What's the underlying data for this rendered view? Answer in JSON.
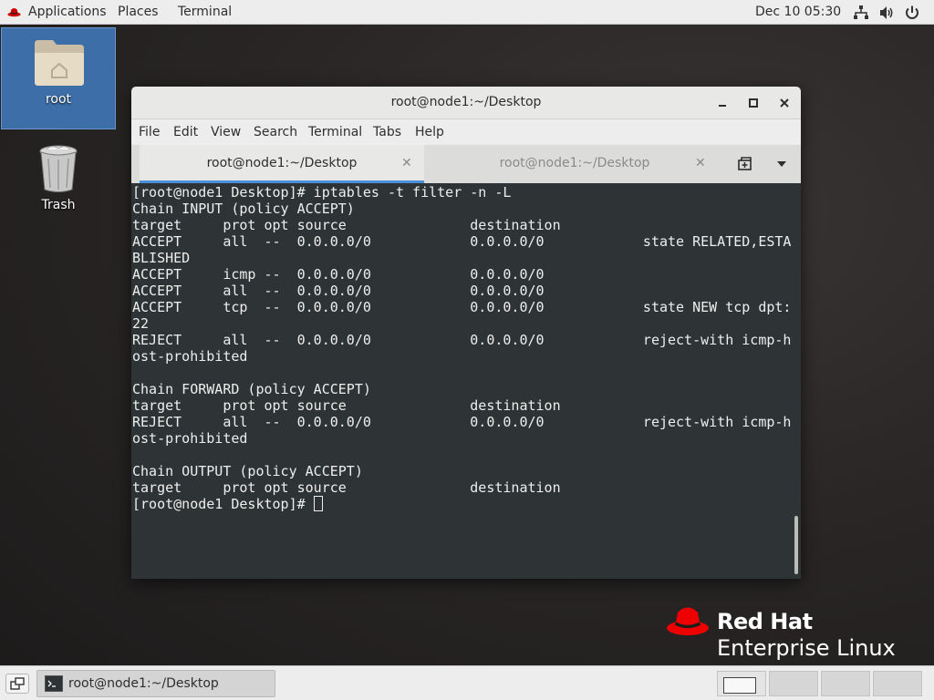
{
  "topbar": {
    "applications": "Applications",
    "places": "Places",
    "terminal": "Terminal",
    "clock": "Dec 10  05:30",
    "icons": [
      "network-icon",
      "volume-icon",
      "power-icon"
    ]
  },
  "desktop": {
    "icons": [
      {
        "label": "root",
        "icon": "home-folder-icon",
        "selected": true
      },
      {
        "label": "Trash",
        "icon": "trash-icon",
        "selected": false
      }
    ]
  },
  "window": {
    "title": "root@node1:~/Desktop",
    "menu": [
      "File",
      "Edit",
      "View",
      "Search",
      "Terminal",
      "Tabs",
      "Help"
    ],
    "tabs": [
      {
        "label": "root@node1:~/Desktop",
        "active": true
      },
      {
        "label": "root@node1:~/Desktop",
        "active": false
      }
    ],
    "terminal_lines": [
      "[root@node1 Desktop]# iptables -t filter -n -L",
      "Chain INPUT (policy ACCEPT)",
      "target     prot opt source               destination",
      "ACCEPT     all  --  0.0.0.0/0            0.0.0.0/0            state RELATED,ESTA",
      "BLISHED",
      "ACCEPT     icmp --  0.0.0.0/0            0.0.0.0/0",
      "ACCEPT     all  --  0.0.0.0/0            0.0.0.0/0",
      "ACCEPT     tcp  --  0.0.0.0/0            0.0.0.0/0            state NEW tcp dpt:",
      "22",
      "REJECT     all  --  0.0.0.0/0            0.0.0.0/0            reject-with icmp-h",
      "ost-prohibited",
      "",
      "Chain FORWARD (policy ACCEPT)",
      "target     prot opt source               destination",
      "REJECT     all  --  0.0.0.0/0            0.0.0.0/0            reject-with icmp-h",
      "ost-prohibited",
      "",
      "Chain OUTPUT (policy ACCEPT)",
      "target     prot opt source               destination"
    ],
    "prompt": "[root@node1 Desktop]# "
  },
  "branding": {
    "line1": "Red Hat",
    "line2": "Enterprise Linux",
    "accent": "#ee0000"
  },
  "taskbar": {
    "task_label": "root@node1:~/Desktop",
    "workspaces": 4,
    "active_workspace": 1
  }
}
